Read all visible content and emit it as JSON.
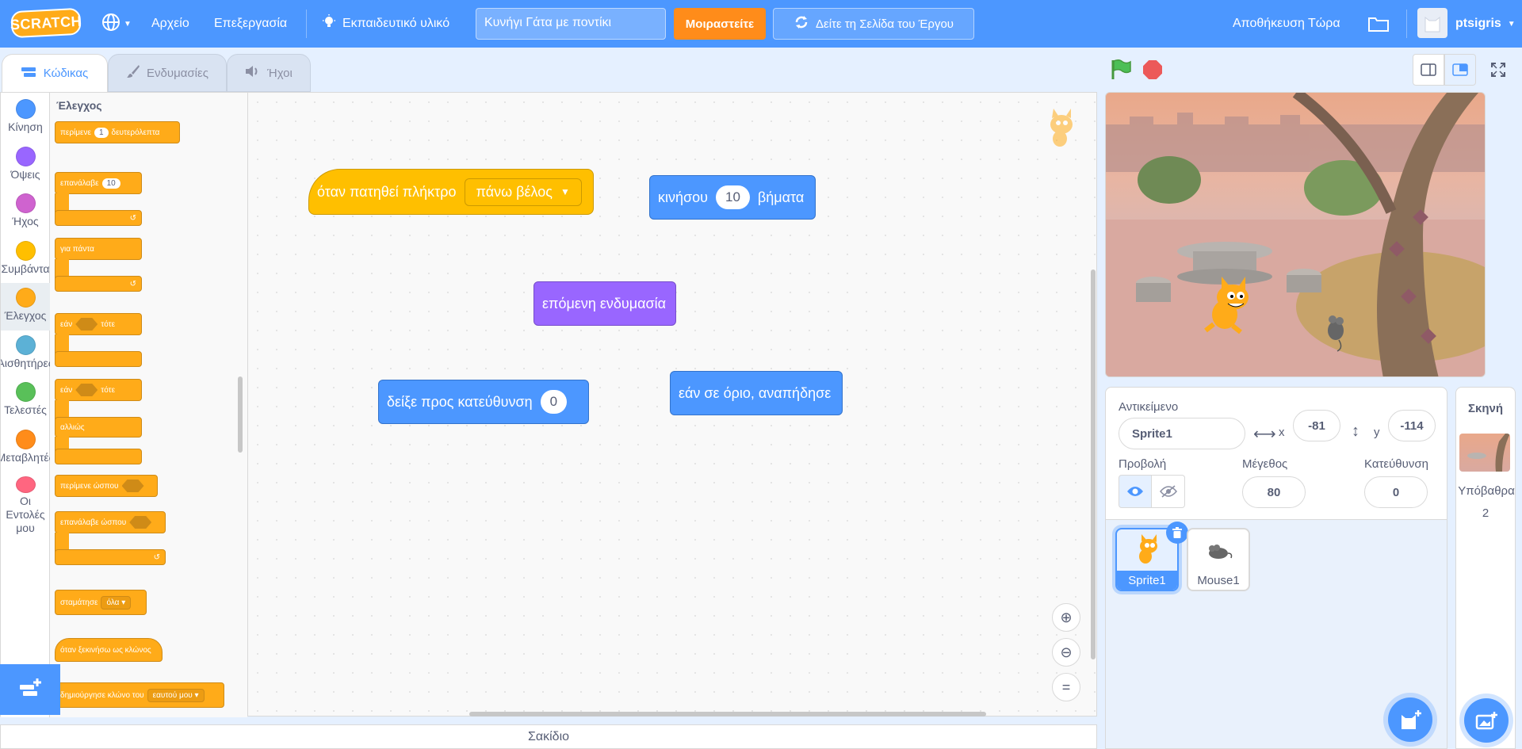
{
  "menubar": {
    "logo": "SCRATCH",
    "file": "Αρχείο",
    "edit": "Επεξεργασία",
    "tutorials": "Εκπαιδευτικό υλικό",
    "project_title": "Κυνήγι Γάτα με ποντίκι",
    "share": "Μοιραστείτε",
    "see_project_page": "Δείτε τη Σελίδα του Έργου",
    "save_now": "Αποθήκευση Τώρα",
    "username": "ptsigris"
  },
  "tabs": {
    "code": "Κώδικας",
    "costumes": "Ενδυμασίες",
    "sounds": "Ήχοι"
  },
  "categories": [
    {
      "label": "Κίνηση",
      "color": "#4c97ff"
    },
    {
      "label": "Όψεις",
      "color": "#9966ff"
    },
    {
      "label": "Ήχος",
      "color": "#cf63cf"
    },
    {
      "label": "Συμβάντα",
      "color": "#ffbf00"
    },
    {
      "label": "Έλεγχος",
      "color": "#ffab19"
    },
    {
      "label": "Αισθητήρες",
      "color": "#5cb1d6"
    },
    {
      "label": "Τελεστές",
      "color": "#59c059"
    },
    {
      "label": "Μεταβλητές",
      "color": "#ff8c1a"
    },
    {
      "label": "Οι Εντολές μου",
      "color": "#ff6680"
    }
  ],
  "flyout": {
    "heading": "Έλεγχος",
    "wait_pre": "περίμενε",
    "wait_val": "1",
    "wait_post": "δευτερόλεπτα",
    "repeat": "επανάλαβε",
    "repeat_val": "10",
    "forever": "για πάντα",
    "if": "εάν",
    "then": "τότε",
    "else": "αλλιώς",
    "wait_until": "περίμενε ώσπου",
    "repeat_until": "επανάλαβε ώσπου",
    "stop": "σταμάτησε",
    "stop_val": "όλα",
    "clone_start": "όταν ξεκινήσω ως κλώνος",
    "create_clone": "δημιούργησε κλώνο του",
    "create_clone_val": "εαυτού μου"
  },
  "workspace": {
    "when_key_pressed": "όταν πατηθεί πλήκτρο",
    "key_value": "πάνω βέλος",
    "move": "κινήσου",
    "move_val": "10",
    "steps": "βήματα",
    "next_costume": "επόμενη ενδυμασία",
    "point_in_direction": "δείξε προς κατεύθυνση",
    "direction_val": "0",
    "bounce": "εάν σε όριο, αναπήδησε"
  },
  "backpack": "Σακίδιο",
  "sprite_info": {
    "sprite_label": "Αντικείμενο",
    "sprite_name": "Sprite1",
    "x_label": "x",
    "x_value": "-81",
    "y_label": "y",
    "y_value": "-114",
    "show_label": "Προβολή",
    "size_label": "Μέγεθος",
    "size_value": "80",
    "direction_label": "Κατεύθυνση",
    "direction_value": "0"
  },
  "sprites": [
    {
      "name": "Sprite1",
      "selected": true
    },
    {
      "name": "Mouse1",
      "selected": false
    }
  ],
  "stage_panel": {
    "title": "Σκηνή",
    "backdrops_label": "Υπόβαθρα",
    "backdrops_count": "2"
  },
  "colors": {
    "menubar": "#4c97ff",
    "control": "#ffab19",
    "motion": "#4c97ff",
    "looks": "#9966ff",
    "events": "#ffbf00",
    "share": "#ff8c1a"
  }
}
